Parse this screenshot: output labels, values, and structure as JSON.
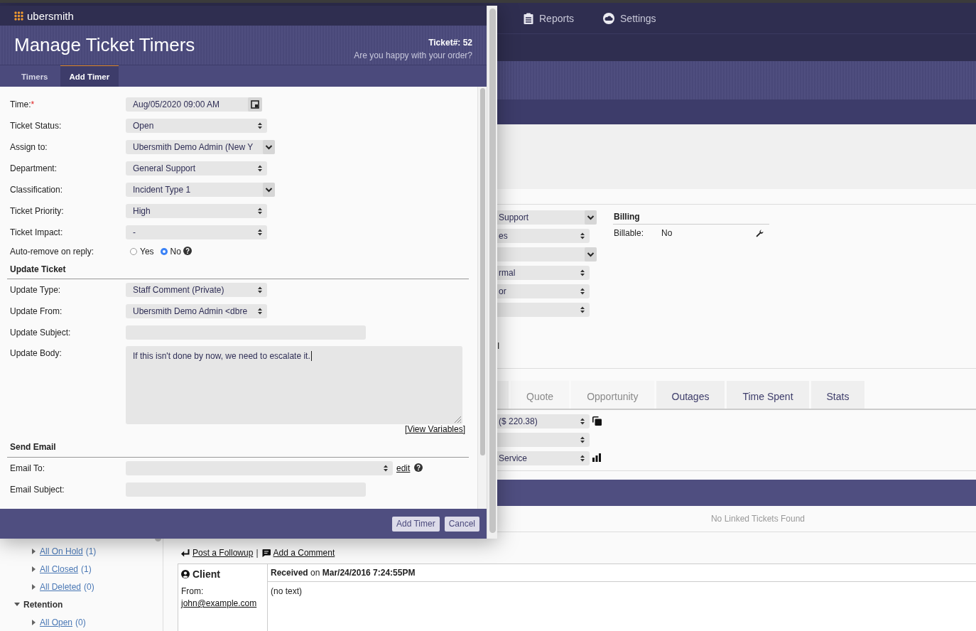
{
  "background": {
    "nav": [
      {
        "label": "Reports"
      },
      {
        "label": "Settings"
      }
    ],
    "fields": [
      {
        "kind": "dropdown",
        "value": "Support"
      },
      {
        "kind": "select",
        "value": "es"
      },
      {
        "kind": "dropdown"
      },
      {
        "kind": "select",
        "value": "rmal"
      },
      {
        "kind": "select",
        "value": "or"
      },
      {
        "kind": "select"
      }
    ],
    "fragment": "I",
    "billing": {
      "title": "Billing",
      "label": "Billable:",
      "value": "No"
    },
    "tabs": [
      {
        "selected": false
      },
      {
        "label": "Quote",
        "selected": false,
        "disabled": true
      },
      {
        "label": "Opportunity",
        "selected": false,
        "disabled": true
      },
      {
        "label": "Outages",
        "selected": false,
        "disabled": false
      },
      {
        "label": "Time Spent",
        "selected": false,
        "disabled": false
      },
      {
        "label": "Stats",
        "selected": false,
        "disabled": false
      }
    ],
    "service_fields": [
      {
        "kind": "select",
        "value": "($ 220.38)"
      },
      {
        "kind": "select"
      },
      {
        "kind": "select",
        "value": "Service"
      }
    ],
    "linked_tickets": {
      "message": "No Linked Tickets Found"
    },
    "sidebar": {
      "items": [
        {
          "label": "All On Hold",
          "count": "(1)",
          "expanded": false
        },
        {
          "label": "All Closed",
          "count": "(1)",
          "expanded": false
        },
        {
          "label": "All Deleted",
          "count": "(0)",
          "expanded": false
        }
      ],
      "sections": [
        {
          "label": "Retention",
          "expanded": true,
          "children": [
            {
              "label": "All Open",
              "count": "(0)",
              "expanded": false
            }
          ]
        }
      ]
    },
    "thread": {
      "actions": [
        {
          "label": "Post a Followup"
        },
        {
          "label": "Add a Comment"
        }
      ],
      "separator": "|",
      "message": {
        "author": "Client",
        "from_label": "From:",
        "from": "john@example.com",
        "received": "**Received** on **Mar/24/2016 7:24:55PM**",
        "body": "(no text)"
      }
    }
  },
  "dialog": {
    "brand": "ubersmith",
    "title": "Manage Ticket Timers",
    "ticket": "Ticket#: 52",
    "subtitle": "Are you happy with your order?",
    "tabs": [
      {
        "label": "Timers",
        "selected": false
      },
      {
        "label": "Add Timer",
        "selected": true
      }
    ],
    "sections": [
      {
        "fields": [
          {
            "kind": "date",
            "label": "Time:",
            "mark": "*",
            "value": "Aug/05/2020 09:00 AM"
          },
          {
            "kind": "select",
            "label": "Ticket Status:",
            "value": "Open"
          },
          {
            "kind": "dropdown",
            "label": "Assign to:",
            "value": "Ubersmith Demo Admin (New Y"
          },
          {
            "kind": "select",
            "label": "Department:",
            "value": "General Support"
          },
          {
            "kind": "dropdown",
            "label": "Classification:",
            "value": "Incident Type 1"
          },
          {
            "kind": "select",
            "label": "Ticket Priority:",
            "value": "High"
          },
          {
            "kind": "select",
            "label": "Ticket Impact:",
            "value": "-"
          },
          {
            "kind": "radio",
            "label": "Auto-remove on reply:",
            "help": true,
            "options": [
              {
                "label": "Yes",
                "selected": false
              },
              {
                "label": "No",
                "selected": true
              }
            ]
          }
        ]
      },
      {
        "title": "Update Ticket",
        "fields": [
          {
            "kind": "select",
            "label": "Update Type:",
            "value": "Staff Comment (Private)"
          },
          {
            "kind": "select",
            "label": "Update From:",
            "value": "Ubersmith Demo Admin <dbre"
          },
          {
            "kind": "text",
            "label": "Update Subject:"
          },
          {
            "kind": "textarea",
            "label": "Update Body:",
            "value": "If this isn't done by now, we need to escalate it.",
            "focused": true,
            "link": "[View Variables]"
          }
        ]
      },
      {
        "title": "Send Email",
        "fields": [
          {
            "kind": "recipient",
            "label": "Email To:",
            "link": "edit",
            "help": true
          },
          {
            "kind": "text",
            "label": "Email Subject:"
          }
        ]
      }
    ],
    "buttons": [
      "Add Timer",
      "Cancel"
    ]
  }
}
